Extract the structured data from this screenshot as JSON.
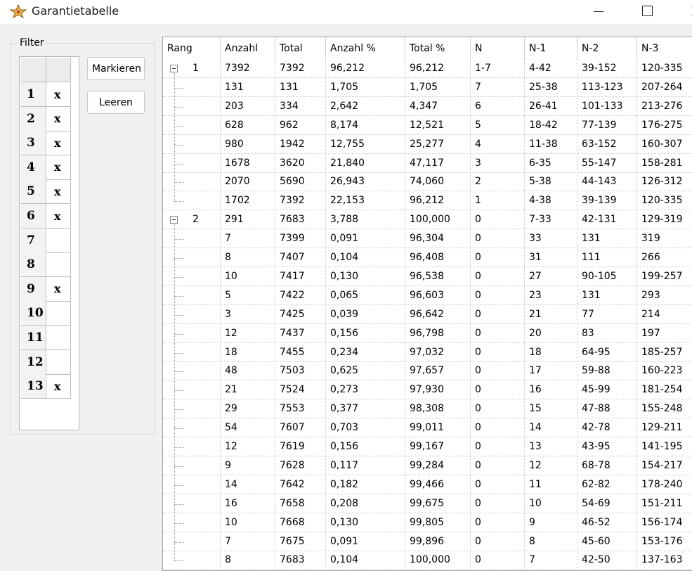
{
  "window": {
    "title": "Garantietabelle"
  },
  "filter": {
    "legend": "Filter",
    "rows": [
      {
        "num": "1",
        "mark": "x"
      },
      {
        "num": "2",
        "mark": "x"
      },
      {
        "num": "3",
        "mark": "x"
      },
      {
        "num": "4",
        "mark": "x"
      },
      {
        "num": "5",
        "mark": "x"
      },
      {
        "num": "6",
        "mark": "x"
      },
      {
        "num": "7",
        "mark": ""
      },
      {
        "num": "8",
        "mark": ""
      },
      {
        "num": "9",
        "mark": "x"
      },
      {
        "num": "10",
        "mark": ""
      },
      {
        "num": "11",
        "mark": ""
      },
      {
        "num": "12",
        "mark": ""
      },
      {
        "num": "13",
        "mark": "x"
      }
    ],
    "mark_button": "Markieren",
    "clear_button": "Leeren"
  },
  "table": {
    "columns": [
      "Rang",
      "Anzahl",
      "Total",
      "Anzahl %",
      "Total %",
      "N",
      "N-1",
      "N-2",
      "N-3"
    ],
    "rows": [
      {
        "level": 0,
        "rang": "1",
        "cells": [
          "7392",
          "7392",
          "96,212",
          "96,212",
          "1-7",
          "4-42",
          "39-152",
          "120-335"
        ]
      },
      {
        "level": 1,
        "rang": "",
        "cells": [
          "131",
          "131",
          "1,705",
          "1,705",
          "7",
          "25-38",
          "113-123",
          "207-264"
        ]
      },
      {
        "level": 1,
        "rang": "",
        "cells": [
          "203",
          "334",
          "2,642",
          "4,347",
          "6",
          "26-41",
          "101-133",
          "213-276"
        ]
      },
      {
        "level": 1,
        "rang": "",
        "cells": [
          "628",
          "962",
          "8,174",
          "12,521",
          "5",
          "18-42",
          "77-139",
          "176-275"
        ]
      },
      {
        "level": 1,
        "rang": "",
        "cells": [
          "980",
          "1942",
          "12,755",
          "25,277",
          "4",
          "11-38",
          "63-152",
          "160-307"
        ]
      },
      {
        "level": 1,
        "rang": "",
        "cells": [
          "1678",
          "3620",
          "21,840",
          "47,117",
          "3",
          "6-35",
          "55-147",
          "158-281"
        ]
      },
      {
        "level": 1,
        "rang": "",
        "cells": [
          "2070",
          "5690",
          "26,943",
          "74,060",
          "2",
          "5-38",
          "44-143",
          "126-312"
        ]
      },
      {
        "level": 1,
        "rang": "",
        "cells": [
          "1702",
          "7392",
          "22,153",
          "96,212",
          "1",
          "4-38",
          "39-139",
          "120-335"
        ]
      },
      {
        "level": 0,
        "rang": "2",
        "cells": [
          "291",
          "7683",
          "3,788",
          "100,000",
          "0",
          "7-33",
          "42-131",
          "129-319"
        ]
      },
      {
        "level": 1,
        "rang": "",
        "cells": [
          "7",
          "7399",
          "0,091",
          "96,304",
          "0",
          "33",
          "131",
          "319"
        ]
      },
      {
        "level": 1,
        "rang": "",
        "cells": [
          "8",
          "7407",
          "0,104",
          "96,408",
          "0",
          "31",
          "111",
          "266"
        ]
      },
      {
        "level": 1,
        "rang": "",
        "cells": [
          "10",
          "7417",
          "0,130",
          "96,538",
          "0",
          "27",
          "90-105",
          "199-257"
        ]
      },
      {
        "level": 1,
        "rang": "",
        "cells": [
          "5",
          "7422",
          "0,065",
          "96,603",
          "0",
          "23",
          "131",
          "293"
        ]
      },
      {
        "level": 1,
        "rang": "",
        "cells": [
          "3",
          "7425",
          "0,039",
          "96,642",
          "0",
          "21",
          "77",
          "214"
        ]
      },
      {
        "level": 1,
        "rang": "",
        "cells": [
          "12",
          "7437",
          "0,156",
          "96,798",
          "0",
          "20",
          "83",
          "197"
        ]
      },
      {
        "level": 1,
        "rang": "",
        "cells": [
          "18",
          "7455",
          "0,234",
          "97,032",
          "0",
          "18",
          "64-95",
          "185-257"
        ]
      },
      {
        "level": 1,
        "rang": "",
        "cells": [
          "48",
          "7503",
          "0,625",
          "97,657",
          "0",
          "17",
          "59-88",
          "160-223"
        ]
      },
      {
        "level": 1,
        "rang": "",
        "cells": [
          "21",
          "7524",
          "0,273",
          "97,930",
          "0",
          "16",
          "45-99",
          "181-254"
        ]
      },
      {
        "level": 1,
        "rang": "",
        "cells": [
          "29",
          "7553",
          "0,377",
          "98,308",
          "0",
          "15",
          "47-88",
          "155-248"
        ]
      },
      {
        "level": 1,
        "rang": "",
        "cells": [
          "54",
          "7607",
          "0,703",
          "99,011",
          "0",
          "14",
          "42-78",
          "129-211"
        ]
      },
      {
        "level": 1,
        "rang": "",
        "cells": [
          "12",
          "7619",
          "0,156",
          "99,167",
          "0",
          "13",
          "43-95",
          "141-195"
        ]
      },
      {
        "level": 1,
        "rang": "",
        "cells": [
          "9",
          "7628",
          "0,117",
          "99,284",
          "0",
          "12",
          "68-78",
          "154-217"
        ]
      },
      {
        "level": 1,
        "rang": "",
        "cells": [
          "14",
          "7642",
          "0,182",
          "99,466",
          "0",
          "11",
          "62-82",
          "178-240"
        ]
      },
      {
        "level": 1,
        "rang": "",
        "cells": [
          "16",
          "7658",
          "0,208",
          "99,675",
          "0",
          "10",
          "54-69",
          "151-211"
        ]
      },
      {
        "level": 1,
        "rang": "",
        "cells": [
          "10",
          "7668",
          "0,130",
          "99,805",
          "0",
          "9",
          "46-52",
          "156-174"
        ]
      },
      {
        "level": 1,
        "rang": "",
        "cells": [
          "7",
          "7675",
          "0,091",
          "99,896",
          "0",
          "8",
          "45-60",
          "153-176"
        ]
      },
      {
        "level": 1,
        "rang": "",
        "cells": [
          "8",
          "7683",
          "0,104",
          "100,000",
          "0",
          "7",
          "42-50",
          "137-163"
        ]
      }
    ]
  }
}
